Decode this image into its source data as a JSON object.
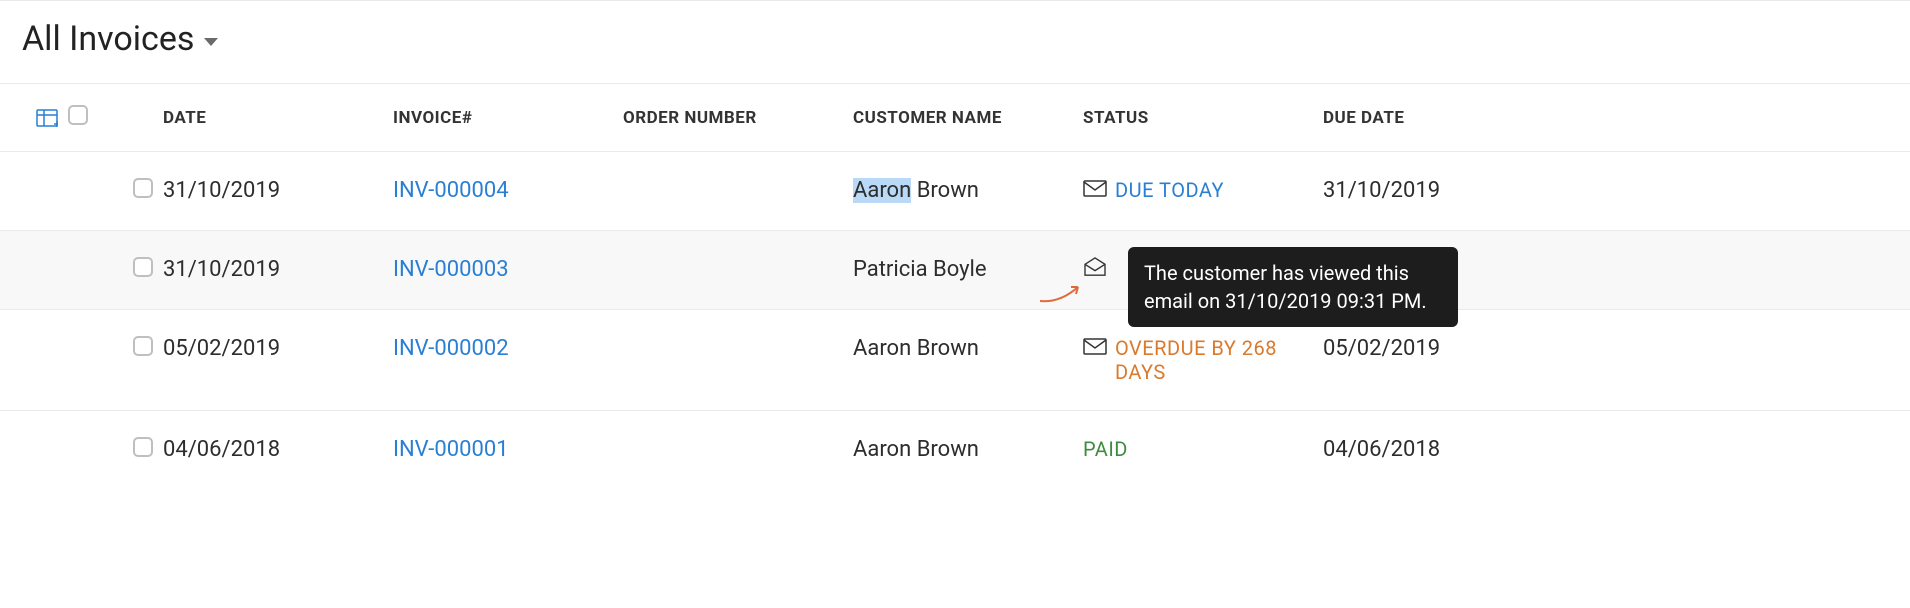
{
  "header": {
    "title": "All Invoices"
  },
  "columns": {
    "date": "DATE",
    "invoice": "INVOICE#",
    "order": "ORDER NUMBER",
    "customer": "CUSTOMER NAME",
    "status": "STATUS",
    "due": "DUE DATE"
  },
  "rows": [
    {
      "date": "31/10/2019",
      "invoice": "INV-000004",
      "order": "",
      "customer_first": "Aaron",
      "customer_rest": " Brown",
      "status_kind": "due",
      "status_text": "DUE TODAY",
      "envelope": "closed",
      "due": "31/10/2019"
    },
    {
      "date": "31/10/2019",
      "invoice": "INV-000003",
      "order": "",
      "customer": "Patricia Boyle",
      "status_kind": "hidden",
      "envelope": "open",
      "due": ""
    },
    {
      "date": "05/02/2019",
      "invoice": "INV-000002",
      "order": "",
      "customer": "Aaron Brown",
      "status_kind": "overdue",
      "status_text": "OVERDUE BY 268 DAYS",
      "envelope": "closed",
      "due": "05/02/2019"
    },
    {
      "date": "04/06/2018",
      "invoice": "INV-000001",
      "order": "",
      "customer": "Aaron Brown",
      "status_kind": "paid",
      "status_text": "PAID",
      "envelope": "none",
      "due": "04/06/2018"
    }
  ],
  "tooltip": "The customer has viewed this email on 31/10/2019 09:31 PM."
}
